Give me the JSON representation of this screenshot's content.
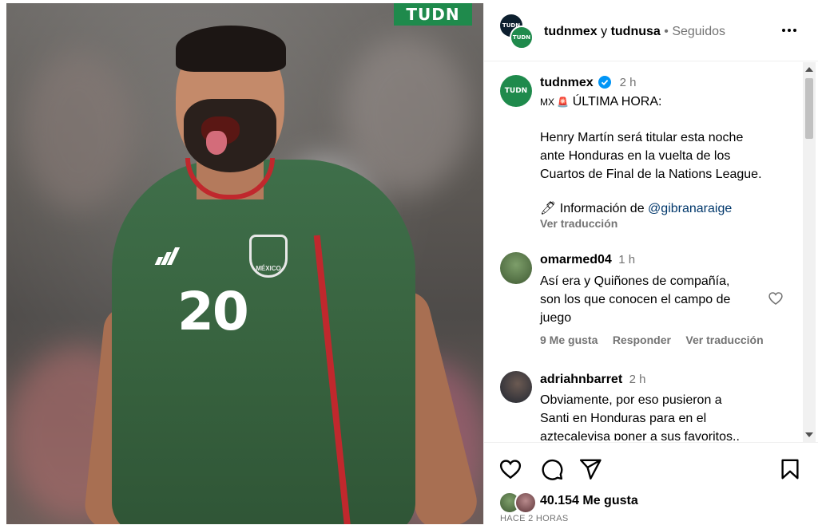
{
  "photo": {
    "brand_logo": "TUDN",
    "jersey_number": "20",
    "badge_text": "MÉXICO"
  },
  "header": {
    "user1": "tudnmex",
    "connector": "y",
    "user2": "tudnusa",
    "dot": "•",
    "follow_status": "Seguidos",
    "more_icon": "more-dots-icon"
  },
  "post": {
    "author": "tudnmex",
    "time": "2 h",
    "line1_prefix": "MX 🚨",
    "line1_text": "ÚLTIMA HORA:",
    "body": "Henry Martín será titular esta noche\nante Honduras en la vuelta de los\nCuartos de Final de la Nations League.",
    "info_prefix": "🖊 Información de",
    "info_mention": "@gibranaraige",
    "translate": "Ver traducción"
  },
  "comments": [
    {
      "author": "omarmed04",
      "time": "1 h",
      "text": "Así era y Quiñones de compañía,\nson los que conocen el campo de\njuego",
      "likes": "9 Me gusta",
      "reply": "Responder",
      "translate": "Ver traducción"
    },
    {
      "author": "adriahnbarret",
      "time": "2 h",
      "text": "Obviamente, por eso pusieron a\nSanti en Honduras para en el\naztecalevisa poner a sus favoritos.."
    }
  ],
  "footer": {
    "likes": "40.154 Me gusta",
    "posted": "HACE 2 HORAS"
  },
  "colors": {
    "brand_green": "#1f8a4c",
    "verified_blue": "#0095f6",
    "mention": "#00376b",
    "muted": "#737373"
  }
}
